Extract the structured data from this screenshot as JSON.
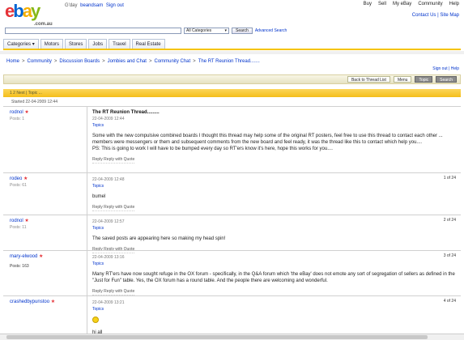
{
  "header": {
    "logo_letters": [
      "e",
      "b",
      "a",
      "y"
    ],
    "logo_sub": ".com.au",
    "greeting": "G'day",
    "username_link": "beandsam",
    "signout": "Sign out",
    "nav": [
      "Buy",
      "Sell",
      "My eBay",
      "Community",
      "Help"
    ],
    "sublinks": "Contact Us | Site Map"
  },
  "search": {
    "placeholder": "",
    "category": "All Categories",
    "button": "Search",
    "advanced": "Advanced Search"
  },
  "tabs": [
    "Categories",
    "Motors",
    "Stores",
    "Jobs",
    "Travel",
    "Real Estate"
  ],
  "breadcrumb": [
    "Home",
    "Community",
    "Discussion Boards",
    "Jombies and Chat",
    "Community Chat",
    "The RT Reunion Thread......."
  ],
  "right_links": "Sign out | Help",
  "toolbar": {
    "back": "Back to Thread List",
    "menu": "Menu",
    "topic": "Topic",
    "search": "Search"
  },
  "thread_bar": "1  2  Next  |  Topic ...",
  "thread_date": "Started 22-04-2009 12:44",
  "posts": [
    {
      "user": "rodnol",
      "rating": "Posts: 1",
      "title": "The RT Reunion Thread.........",
      "date": "22-04-2009 12:44",
      "link": "Topics",
      "text": "Some with the new compulsive combined boards I thought this thread may help some of the original RT posters, feel free to use this thread to contact each other ... members were messengers or them and subsequent comments from the new board and feel ready, it was the thread like this to contact which help you....\nPS: This is going to work I will have to be bumped every day so RT'ers know it's here, hope this works for you....",
      "reply": "Reply  Reply with Quote",
      "num": "",
      "num_link": ""
    },
    {
      "user": "rodeo",
      "rating": "Posts: 61",
      "title": "",
      "date": "22-04-2009 12:48",
      "link": "Topics",
      "text": "bumel",
      "reply": "Reply  Reply with Quote",
      "num": "1 of 24",
      "num_link": "Topic"
    },
    {
      "user": "rodnol",
      "rating": "Posts: 11",
      "title": "",
      "date": "22-04-2009 12:57",
      "link": "Topics",
      "text": "The saved posts are appearing here so making my head spin!",
      "reply": "Reply  Reply with Quote",
      "num": "2 of 24",
      "num_link": ""
    },
    {
      "user": "mary-elwood",
      "rating": "Posts: 163",
      "title": "",
      "date": "22-04-2009 13:16",
      "link": "Topics",
      "text": "Many RT'ers have now sought refuge in the OX forum - specifically, in the Q&A forum which 'the eBay' does not emote any sort of segregation of sellers as defined in the \"Just for Fun\" table. Yes, the OX forum has a round table. And the people there are welcoming and wonderful.",
      "reply": "Reply  Reply with Quote",
      "num": "3 of 24",
      "num_link": "Topic"
    },
    {
      "user": "crashedbypunstoo",
      "rating": "",
      "title": "",
      "date": "22-04-2009 13:21",
      "link": "Topics",
      "text": "hi all",
      "reply": "",
      "num": "4 of 24",
      "num_link": "Topic"
    }
  ],
  "colors": {
    "accent": "#f5c400",
    "link": "#0033cc"
  }
}
